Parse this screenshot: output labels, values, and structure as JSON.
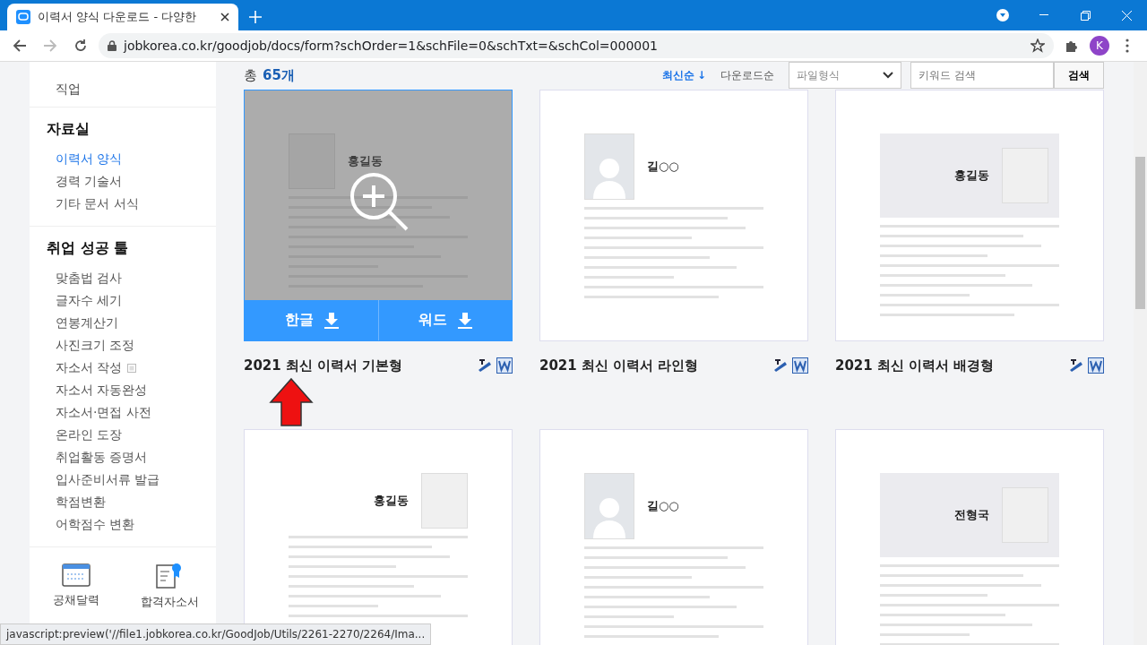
{
  "browser": {
    "tab_title": "이력서 양식 다운로드 - 다양한",
    "url": "jobkorea.co.kr/goodjob/docs/form?schOrder=1&schFile=0&schTxt=&schCol=000001",
    "profile_initial": "K",
    "status_text": "javascript:preview('//file1.jobkorea.co.kr/GoodJob/Utils/2261-2270/2264/Ima..."
  },
  "sidebar": {
    "top_item": "직업",
    "sections": [
      {
        "title": "자료실",
        "items": [
          {
            "label": "이력서 양식",
            "selected": true,
            "external": false
          },
          {
            "label": "경력 기술서",
            "selected": false,
            "external": false
          },
          {
            "label": "기타 문서 서식",
            "selected": false,
            "external": false
          }
        ]
      },
      {
        "title": "취업 성공 툴",
        "items": [
          {
            "label": "맞춤법 검사",
            "selected": false,
            "external": false
          },
          {
            "label": "글자수 세기",
            "selected": false,
            "external": false
          },
          {
            "label": "연봉계산기",
            "selected": false,
            "external": false
          },
          {
            "label": "사진크기 조정",
            "selected": false,
            "external": false
          },
          {
            "label": "자소서 작성",
            "selected": false,
            "external": true
          },
          {
            "label": "자소서 자동완성",
            "selected": false,
            "external": false
          },
          {
            "label": "자소서·면접 사전",
            "selected": false,
            "external": false
          },
          {
            "label": "온라인 도장",
            "selected": false,
            "external": false
          },
          {
            "label": "취업활동 증명서",
            "selected": false,
            "external": false
          },
          {
            "label": "입사준비서류 발급",
            "selected": false,
            "external": false
          },
          {
            "label": "학점변환",
            "selected": false,
            "external": false
          },
          {
            "label": "어학점수 변환",
            "selected": false,
            "external": false
          }
        ]
      }
    ],
    "shortcuts": [
      {
        "label": "공채달력",
        "kind": "calendar"
      },
      {
        "label": "합격자소서",
        "kind": "certificate"
      }
    ]
  },
  "toolbar": {
    "total_label": "총",
    "total_count": "65개",
    "sorts": [
      {
        "label": "최신순",
        "selected": true,
        "indicator": "↓"
      },
      {
        "label": "다운로드순",
        "selected": false
      }
    ],
    "file_type": "파일형식",
    "search_placeholder": "키워드 검색",
    "search_button": "검색"
  },
  "hover_downloads": [
    "한글",
    "워드"
  ],
  "cards": [
    {
      "title": "2021 최신 이력서 기본형",
      "hovered": true,
      "kind": "photo-left",
      "name": "홍길동"
    },
    {
      "title": "2021 최신 이력서 라인형",
      "hovered": false,
      "kind": "silhouette",
      "name": "길○○"
    },
    {
      "title": "2021 최신 이력서 배경형",
      "hovered": false,
      "kind": "banner",
      "name": "홍길동"
    },
    {
      "hovered": false,
      "kind": "photo-right",
      "name": "홍길동"
    },
    {
      "hovered": false,
      "kind": "silhouette",
      "name": "길○○"
    },
    {
      "hovered": false,
      "kind": "banner",
      "name": "전형국"
    }
  ]
}
